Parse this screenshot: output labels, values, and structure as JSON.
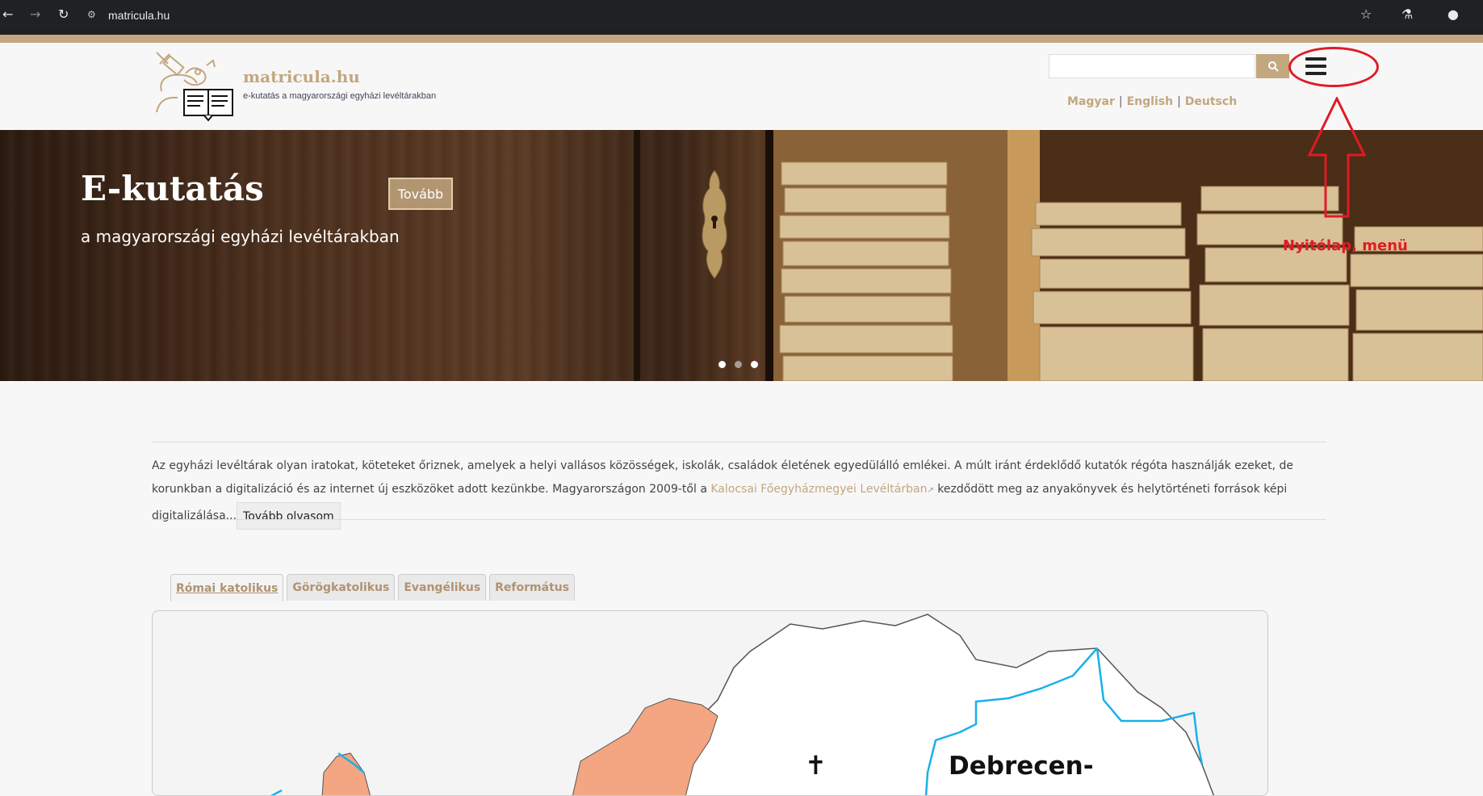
{
  "browser": {
    "url": "matricula.hu",
    "back_icon": "arrow-left-icon",
    "forward_icon": "arrow-right-icon",
    "reload_icon": "reload-icon",
    "bookmark_icon": "star-icon",
    "labs_icon": "flask-icon",
    "profile_icon": "person-icon"
  },
  "header": {
    "site_name": "matricula.hu",
    "tagline": "e-kutatás a magyarországi egyházi levéltárakban",
    "search_placeholder": "",
    "languages": [
      "Magyar",
      "English",
      "Deutsch"
    ],
    "separator": "|"
  },
  "annotation": {
    "label": "Nyitólap, menü",
    "color": "#e01b24"
  },
  "hero": {
    "title": "E-kutatás",
    "subtitle": "a magyarországi egyházi levéltárakban",
    "button": "Tovább",
    "slides": 3,
    "active_slide": 3
  },
  "intro": {
    "text_before_link": "Az egyházi levéltárak olyan iratokat, köteteket őriznek, amelyek a helyi vallásos közösségek, iskolák, családok életének egyedülálló emlékei. A múlt iránt érdeklődő kutatók régóta használják ezeket, de korunkban a digitalizáció és az internet új eszközöket adott kezünkbe. Magyarországon 2009-től a ",
    "link": "Kalocsai Főegyházmegyei Levéltárban",
    "text_after_link": " kezdődött meg az anyakönyvek és helytörténeti források képi digitalizálása...",
    "more_button": "Tovább olvasom"
  },
  "tabs": [
    {
      "label": "Római katolikus",
      "active": true
    },
    {
      "label": "Görögkatolikus",
      "active": false
    },
    {
      "label": "Evangélikus",
      "active": false
    },
    {
      "label": "Református",
      "active": false
    }
  ],
  "map": {
    "region_label": "Debrecen-",
    "cross_symbol": "✝",
    "colors": {
      "selected": "#f4a582",
      "border_blue": "#1ab0e8",
      "outline": "#555555",
      "fill": "#ffffff"
    }
  },
  "colors": {
    "accent": "#c2a77f",
    "chrome": "#202124"
  }
}
